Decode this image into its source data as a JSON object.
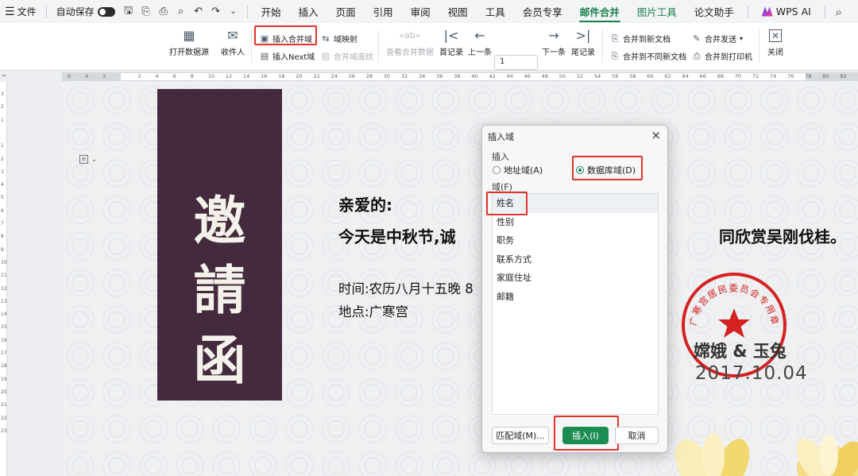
{
  "menubar": {
    "file_label": "文件",
    "autosave_label": "自动保存",
    "tabs": [
      "开始",
      "插入",
      "页面",
      "引用",
      "审阅",
      "视图",
      "工具",
      "会员专享",
      "邮件合并",
      "图片工具",
      "论文助手"
    ],
    "active_tab": "邮件合并",
    "wps_ai_label": "WPS AI"
  },
  "ribbon": {
    "open_datasource": "打开数据源",
    "recipients": "收件人",
    "insert_merge_field": "插入合并域",
    "insert_next_field": "插入Next域",
    "field_mapping": "域映射",
    "merge_field_shading": "合并域底纹",
    "view_merged_data": "查看合并数据",
    "first_record": "首记录",
    "prev_record": "上一条",
    "record_number": "1",
    "next_record": "下一条",
    "last_record": "尾记录",
    "merge_new_doc": "合并到新文档",
    "merge_separate_docs": "合并到不同新文档",
    "merge_send": "合并发送",
    "merge_printer": "合并到打印机",
    "close": "关闭"
  },
  "ruler": {
    "h_ticks": [
      "6",
      "4",
      "2",
      "",
      "2",
      "4",
      "6",
      "8",
      "10",
      "12",
      "14",
      "16",
      "18",
      "20",
      "22",
      "24",
      "26",
      "28",
      "30",
      "32",
      "34",
      "36",
      "38",
      "40",
      "42",
      "44",
      "46",
      "48",
      "50",
      "52",
      "54",
      "56",
      "58",
      "60",
      "62",
      "64",
      "66",
      "68",
      "70",
      "72",
      "74",
      "76",
      "78",
      "80",
      "82"
    ],
    "v_ticks": [
      "3",
      "2",
      "1",
      "",
      "1",
      "2",
      "3",
      "4",
      "5",
      "6",
      "7",
      "8",
      "9",
      "10",
      "11",
      "12",
      "13",
      "14",
      "15",
      "16",
      "17",
      "18",
      "19",
      "20",
      "21",
      "22",
      "23"
    ]
  },
  "document": {
    "banner_chars": [
      "邀",
      "請",
      "函"
    ],
    "greeting": "亲爱的:",
    "invite_line_start": "今天是中秋节,诚",
    "invite_line_end": "同欣赏吴刚伐桂。",
    "time_line": "时间:农历八月十五晚 8",
    "place_line": "地点:广寒宫",
    "signer": "嫦娥 & 玉兔",
    "date": "2017.10.04",
    "stamp_text": "广寒宫居民委员会专用章"
  },
  "dialog": {
    "title": "插入域",
    "insert_label": "插入",
    "address_field": "地址域(A)",
    "database_field": "数据库域(D)",
    "field_label": "域(F)",
    "fields": [
      "姓名",
      "性别",
      "职务",
      "联系方式",
      "家庭住址",
      "邮籍"
    ],
    "selected_field": "姓名",
    "match_fields_button": "匹配域(M)...",
    "insert_button": "插入(I)",
    "cancel_button": "取消"
  },
  "colors": {
    "accent_green": "#1a7f4b",
    "highlight_red": "#e0342c",
    "banner": "#432a3c",
    "stamp_red": "#d42222"
  }
}
